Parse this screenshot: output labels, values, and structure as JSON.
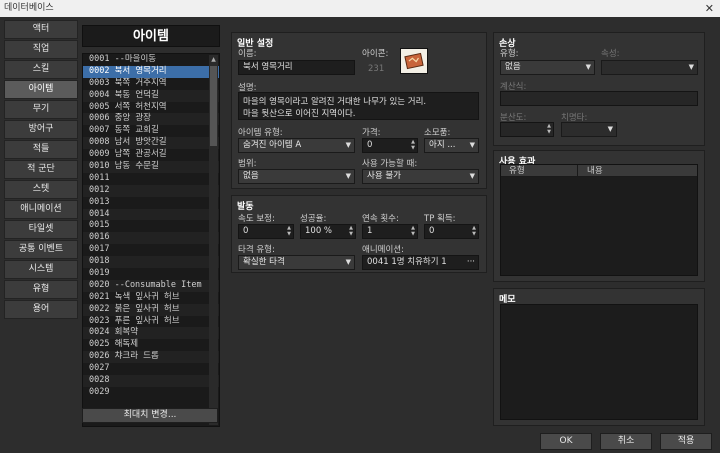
{
  "window": {
    "title": "데이터베이스",
    "close": "✕"
  },
  "tabs": [
    "액터",
    "직업",
    "스킬",
    "아이템",
    "무기",
    "방어구",
    "적들",
    "적 군단",
    "스텟",
    "애니메이션",
    "타일셋",
    "공통 이벤트",
    "시스템",
    "유형",
    "용어"
  ],
  "active_tab": 3,
  "list": {
    "header": "아이템",
    "items": [
      "0001 --마을이동",
      "0002 북서 영목거리",
      "0003 북쪽 거주지역",
      "0004 북동 언덕길",
      "0005 서쪽 허천지역",
      "0006 중앙 광장",
      "0007 동쪽 교회길",
      "0008 남서 방앗간길",
      "0009 남쪽 관공서길",
      "0010 남동 수문길",
      "0011",
      "0012",
      "0013",
      "0014",
      "0015",
      "0016",
      "0017",
      "0018",
      "0019",
      "0020 --Consumable Item",
      "0021 녹색 잎사귀 허브",
      "0022 붉은 잎사귀 허브",
      "0023 푸른 잎사귀 허브",
      "0024 회복약",
      "0025 해독제",
      "0026 챠크라 드롭",
      "0027",
      "0028",
      "0029"
    ],
    "selected": 1,
    "max_button": "최대치 변경..."
  },
  "general": {
    "title": "일반 설정",
    "name_label": "이름:",
    "name_value": "북서 영목거리",
    "icon_label": "아이콘:",
    "icon_index": "231",
    "desc_label": "설명:",
    "desc_line1": "마을의 영목이라고 알려진 거대한 나무가 있는 거리.",
    "desc_line2": "마을 뒷산으로 이어진 지역이다.",
    "type_label": "아이템 유형:",
    "type_value": "숨겨진 아이템 A",
    "price_label": "가격:",
    "price_value": "0",
    "consume_label": "소모품:",
    "consume_value": "아지 ...",
    "scope_label": "범위:",
    "scope_value": "없음",
    "occasion_label": "사용 가능할 때:",
    "occasion_value": "사용 불가"
  },
  "invocation": {
    "title": "발동",
    "speed_label": "속도 보정:",
    "speed_value": "0",
    "success_label": "성공율:",
    "success_value": "100 %",
    "repeat_label": "연속 횟수:",
    "repeat_value": "1",
    "tp_label": "TP 획득:",
    "tp_value": "0",
    "hit_label": "타격 유형:",
    "hit_value": "확실한 타격",
    "anim_label": "애니메이션:",
    "anim_value": "0041 1명 치유하기 1"
  },
  "damage": {
    "title": "손상",
    "type_label": "유형:",
    "type_value": "없음",
    "element_label": "속성:",
    "formula_label": "계산식:",
    "variance_label": "분산도:",
    "critical_label": "치명타:"
  },
  "effects": {
    "title": "사용 효과",
    "col_type": "유형",
    "col_content": "내용"
  },
  "memo": {
    "title": "메모"
  },
  "buttons": {
    "ok": "OK",
    "cancel": "취소",
    "apply": "적용"
  },
  "colors": {
    "selection": "#3c6ea8",
    "background": "#2d2d2d"
  }
}
